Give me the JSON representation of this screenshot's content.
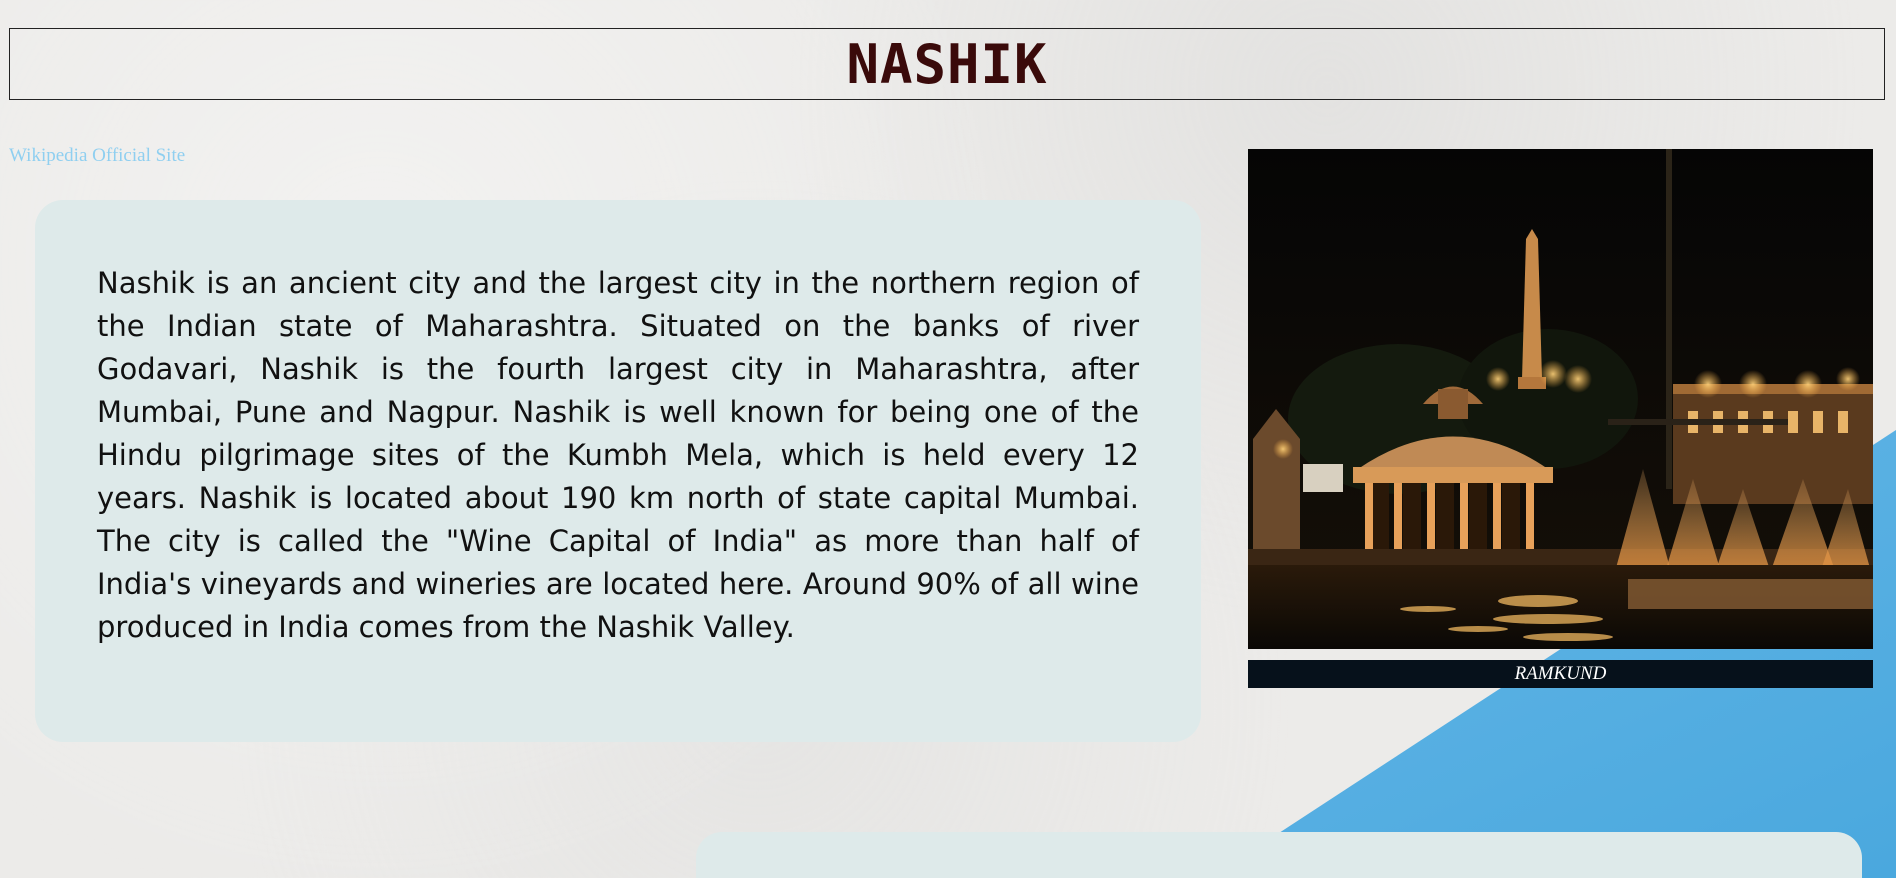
{
  "header": {
    "title": "NASHIK"
  },
  "links": {
    "wikipedia_label": "Wikipedia Official Site"
  },
  "description": {
    "text": "Nashik is an ancient city and the largest city in the northern region of the Indian state of Maharashtra. Situated on the banks of river Godavari, Nashik is the fourth largest city in Maharashtra, after Mumbai, Pune and Nagpur. Nashik is well known for being one of the Hindu pilgrimage sites of the Kumbh Mela, which is held every 12 years. Nashik is located about 190 km north of state capital Mumbai. The city is called the \"Wine Capital of India\" as more than half of India's vineyards and wineries are located here. Around 90% of all wine produced in India comes from the Nashik Valley."
  },
  "photo": {
    "caption": "RAMKUND"
  },
  "colors": {
    "title": "#3a0a0a",
    "link": "#8fcff0",
    "card_background": "#deeaea",
    "caption_background": "#06111b",
    "accent_blue": "#4aa8de"
  }
}
